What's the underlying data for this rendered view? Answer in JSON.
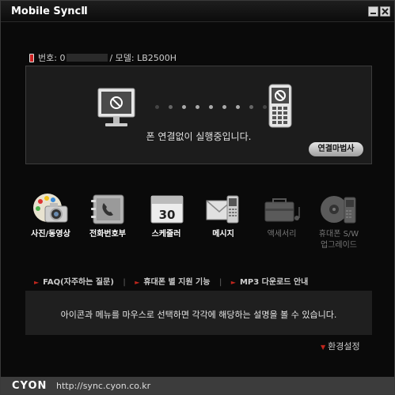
{
  "window": {
    "title": "Mobile SyncⅡ"
  },
  "phone_info": {
    "number_label": "번호: 0",
    "model_text": "/ 모델: LB2500H"
  },
  "status": {
    "message": "폰 연결없이 실행중입니다.",
    "wizard_button": "연결마법사",
    "dot_colors": [
      "#444444",
      "#666666",
      "#aaaaaa",
      "#aaaaaa",
      "#aaaaaa",
      "#aaaaaa",
      "#aaaaaa",
      "#666666",
      "#444444"
    ]
  },
  "functions": [
    {
      "label": "사진/동영상",
      "icon": "photo-video-icon",
      "enabled": true
    },
    {
      "label": "전화번호부",
      "icon": "phonebook-icon",
      "enabled": true
    },
    {
      "label": "스케줄러",
      "icon": "calendar-icon",
      "enabled": true,
      "icon_text": "30"
    },
    {
      "label": "메시지",
      "icon": "message-icon",
      "enabled": true
    },
    {
      "label": "액세서리",
      "icon": "accessory-icon",
      "enabled": false
    },
    {
      "label": "휴대폰 S/W 업그레이드",
      "label_line1": "휴대폰 S/W",
      "label_line2": "업그레이드",
      "icon": "sw-upgrade-icon",
      "enabled": false
    }
  ],
  "links": [
    {
      "label": "FAQ(자주하는 질문)"
    },
    {
      "label": "휴대폰 별 지원 기능"
    },
    {
      "label": "MP3 다운로드 안내"
    }
  ],
  "help_text": "아이콘과 메뉴를 마우스로 선택하면 각각에 해당하는 설명을 볼 수 있습니다.",
  "settings_label": "환경설정",
  "footer": {
    "brand": "CYON",
    "url": "http://sync.cyon.co.kr"
  },
  "colors": {
    "accent_red": "#c0261d",
    "panel_bg": "#1c1c1c",
    "background": "#0a0a0a"
  }
}
